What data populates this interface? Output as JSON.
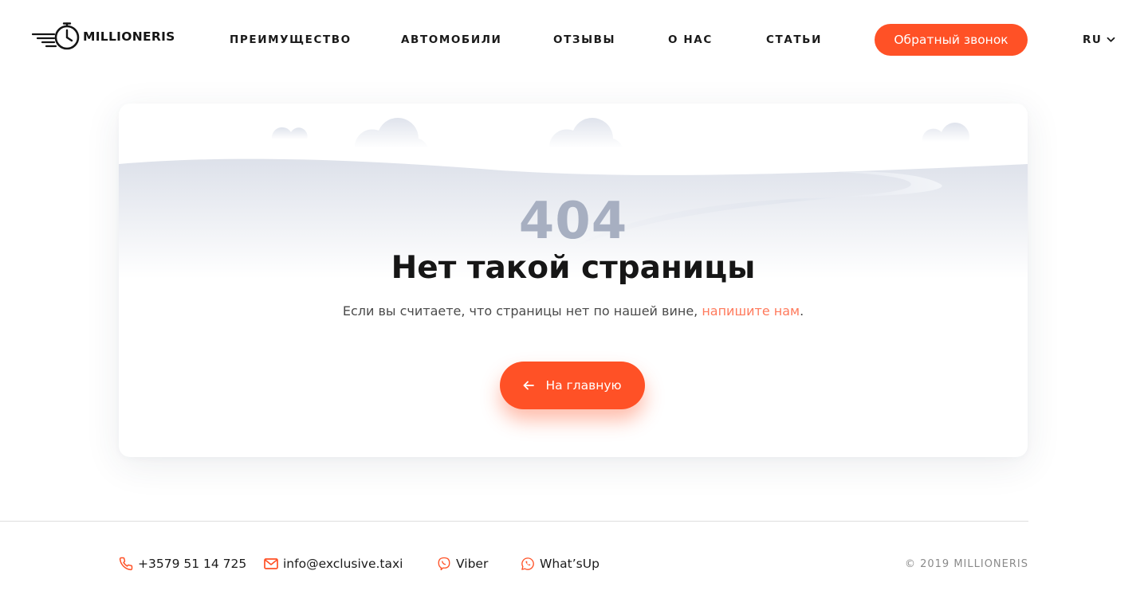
{
  "header": {
    "logo_text": "MILLIONERIS",
    "nav": [
      {
        "label": "ПРЕИМУЩЕСТВО"
      },
      {
        "label": "АВТОМОБИЛИ"
      },
      {
        "label": "ОТЗЫВЫ"
      },
      {
        "label": "О НАС"
      },
      {
        "label": "СТАТЬИ"
      }
    ],
    "callback_label": "Обратный звонок",
    "language": "RU"
  },
  "error": {
    "code": "404",
    "title": "Нет такой страницы",
    "message": "Если вы считаете, что страницы нет по нашей вине, ",
    "link_text": "напишите нам",
    "message_end": ".",
    "home_label": "На главную"
  },
  "footer": {
    "phone": "+3579 51 14 725",
    "email": "info@exclusive.taxi",
    "viber": "Viber",
    "whatsapp": "What’sUp",
    "copyright": "© 2019 MILLIONERIS"
  },
  "icons": {
    "logo": "speed-clock-icon",
    "language_dropdown": "chevron-down-icon",
    "home_button": "arrow-left-icon",
    "phone": "phone-icon",
    "email": "mail-icon",
    "viber": "viber-icon",
    "whatsapp": "whatsapp-icon"
  },
  "colors": {
    "accent": "#ff5126",
    "link": "#ff7a5c",
    "muted_404": "#a7afc1",
    "text": "#1a1a1a"
  }
}
